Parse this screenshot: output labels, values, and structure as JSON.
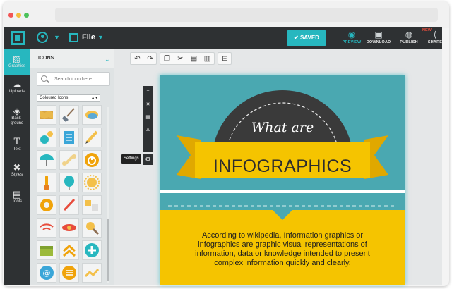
{
  "toolbar": {
    "file_label": "File",
    "saved_label": "SAVED",
    "actions": [
      {
        "label": "PREVIEW",
        "icon": "eye-icon"
      },
      {
        "label": "DOWNLOAD",
        "icon": "download-icon"
      },
      {
        "label": "PUBLISH",
        "icon": "globe-icon"
      },
      {
        "label": "SHARE",
        "icon": "share-icon"
      }
    ],
    "new_badge": "NEW"
  },
  "sidebar": {
    "items": [
      {
        "label": "Graphics",
        "icon": "image-icon",
        "active": true
      },
      {
        "label": "Uploads",
        "icon": "cloud-upload-icon"
      },
      {
        "label": "Back-",
        "label2": "ground",
        "icon": "paint-bucket-icon"
      },
      {
        "label": "Text",
        "icon": "text-icon"
      },
      {
        "label": "Styles",
        "icon": "brush-icon"
      },
      {
        "label": "Tools",
        "icon": "toolbox-icon"
      }
    ]
  },
  "panel": {
    "title": "ICONS",
    "search_placeholder": "Search icon here",
    "filter_value": "Coloured Icons"
  },
  "editor": {
    "settings_tooltip": "Settings"
  },
  "infographic": {
    "heading_top": "What are",
    "heading_main": "INFOGRAPHICS",
    "body": "According to wikipedia, Information graphics or infographics are graphic visual representations of information, data or knowledge intended to present complex information quickly and clearly."
  },
  "colors": {
    "accent": "#27b7bf",
    "dark": "#2e3133",
    "banner_yellow": "#f5c400",
    "page_teal": "#4aa8b1",
    "dome_dark": "#3a3a3a"
  }
}
